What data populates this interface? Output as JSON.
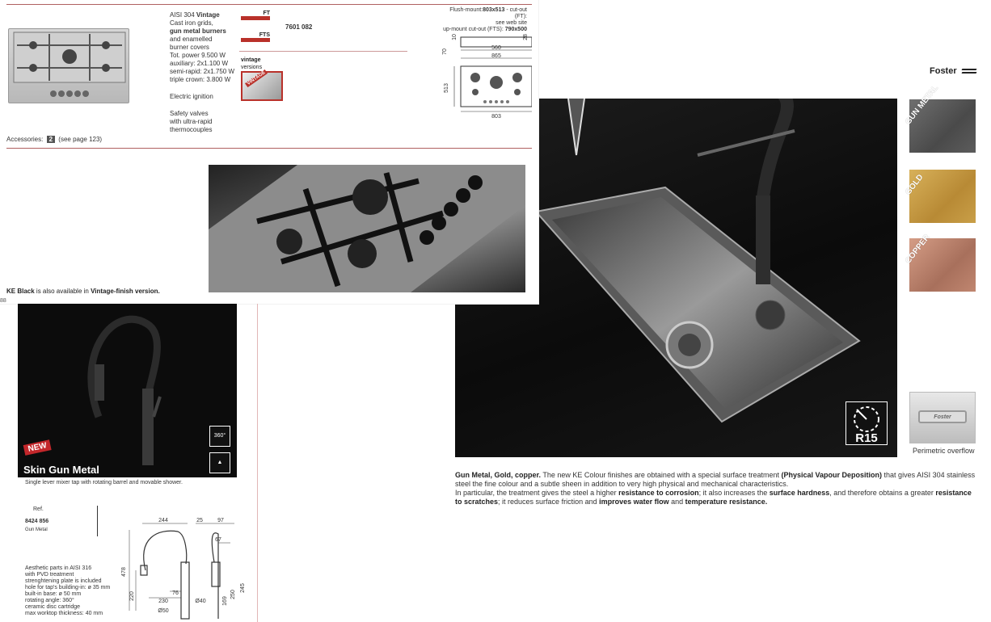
{
  "right_page": {
    "brand": "Foster",
    "title_fragment": "r",
    "swatches": [
      {
        "label": "GUN METAL",
        "color": "#5a5a5a"
      },
      {
        "label": "GOLD",
        "color": "#c99c45"
      },
      {
        "label": "COPPER",
        "color": "#b97d68"
      }
    ],
    "badge": "R15",
    "overflow_caption": "Perimetric overflow",
    "overflow_logo": "Foster",
    "description": {
      "lead": "Gun Metal, Gold, copper.",
      "t1": " The new KE Colour finishes are obtained with a special surface treatment ",
      "b1": "(Physical Vapour Deposition)",
      "t2": " that gives AISI 304 stainless steel the fine colour and a subtle sheen in addition to very high physical and mechanical characteristics.",
      "t3": "In particular, the treatment gives the steel a higher ",
      "b2": "resistance to corrosion",
      "t4": "; it also increases the ",
      "b3": "surface hardness",
      "t5": ", and therefore obtains a greater ",
      "b4": "resistance to scratches",
      "t6": "; it reduces surface friction and  ",
      "b5": "improves water flow",
      "t7": " and ",
      "b6": "temperature resistance."
    }
  },
  "hob_page": {
    "spec_lines": [
      {
        "pre": "AISI 304 ",
        "bold": "Vintage"
      },
      {
        "pre": "Cast iron grids,",
        "bold": ""
      },
      {
        "pre": "",
        "bold": "gun metal burners"
      },
      {
        "pre": "and enamelled",
        "bold": ""
      },
      {
        "pre": "burner covers",
        "bold": ""
      },
      {
        "pre": "Tot. power 9.500 W",
        "bold": ""
      },
      {
        "pre": "auxiliary: 2x1.100 W",
        "bold": ""
      },
      {
        "pre": "semi-rapid: 2x1.750 W",
        "bold": ""
      },
      {
        "pre": "triple crown: 3.800 W",
        "bold": ""
      }
    ],
    "ignition": "Electric ignition",
    "safety": [
      "Safety valves",
      "with ultra-rapid",
      "thermocouples"
    ],
    "accessories_label": "Accessories:",
    "accessories_num": "2",
    "accessories_page": "(see page 123)",
    "type_ft": "FT",
    "type_fts": "FTS",
    "code": "7601 082",
    "vintage_title": "vintage",
    "vintage_sub": "versions",
    "vintage_img_text": "VINTAGE",
    "cutout": {
      "l1_pre": "Flush-mount:",
      "l1_bold": "803x513",
      "l1_post": " -  cut-out (FT):",
      "l2": "see web site",
      "l3_pre": "up-mount cut-out (FTS): ",
      "l3_bold": "790x500"
    },
    "dims": {
      "d1": "560",
      "d2": "865",
      "d3": "803",
      "d4": "513",
      "d5": "70",
      "d6": "28",
      "d7": "10"
    },
    "ke_note_bold": "KE Black",
    "ke_note_mid": " is also available in ",
    "ke_note_bold2": "Vintage-finish version.",
    "page_number": "88"
  },
  "tap_page": {
    "new_badge": "NEW",
    "name": "Skin Gun Metal",
    "subtitle": "Single lever mixer tap with rotating barrel and movable shower.",
    "icon_rotate": "360°",
    "ref_label": "Ref.",
    "ref_code": "8424 856",
    "ref_finish": "Gun Metal",
    "specs": [
      "Aesthetic parts in AISI 316",
      "with PVD treatment",
      "strenghtening plate is included",
      "hole for tap's building-in: ø 35 mm",
      "built-in base: ø 50 mm",
      "rotating angle: 360°",
      "ceramic disc cartridge",
      "max worktop thickness: 40 mm"
    ],
    "dims": {
      "w244": "244",
      "w25": "25",
      "w97": "97",
      "w67": "67",
      "h478": "478",
      "h220": "220",
      "w76": "76",
      "w230": "230",
      "d50": "Ø50",
      "d40": "Ø40",
      "h169": "169",
      "h250": "250",
      "h245": "245"
    }
  }
}
